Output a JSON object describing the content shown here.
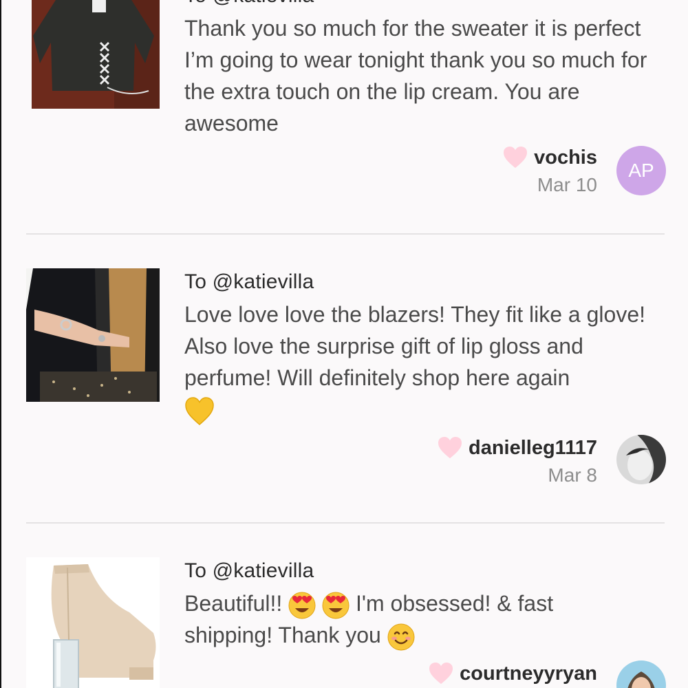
{
  "notes": [
    {
      "to": "To @katievilla",
      "message": "Thank you so much for the sweater it is perfect I’m going to wear tonight thank you so much for the extra touch on the lip cream. You are awesome",
      "username": "vochis",
      "date": "Mar 10",
      "avatar_initials": "AP",
      "thumb_icon": "sweater-photo"
    },
    {
      "to": "To @katievilla",
      "message": "Love love love the blazers! They fit like a glove! Also love the surprise gift of lip gloss and perfume! Will definitely shop here again",
      "username": "danielleg1117",
      "date": "Mar 8",
      "thumb_icon": "blazer-photo"
    },
    {
      "to": "To @katievilla",
      "message_part1": "Beautiful!!",
      "message_part2": "I'm obsessed! & fast",
      "message_part3": "shipping! Thank you",
      "username": "courtneyyryan",
      "thumb_icon": "bootie-photo"
    }
  ],
  "colors": {
    "heart": "#ffd1dd",
    "avatar_bg": "#cea6e8",
    "divider": "#e4e2e3"
  }
}
